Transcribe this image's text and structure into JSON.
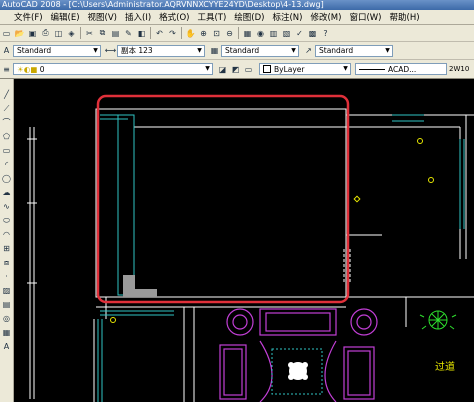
{
  "window": {
    "title": "AutoCAD 2008 - [C:\\Users\\Administrator.AQRVNNXCYYE24YD\\Desktop\\4-13.dwg]"
  },
  "menu": [
    "文件(F)",
    "编辑(E)",
    "视图(V)",
    "插入(I)",
    "格式(O)",
    "工具(T)",
    "绘图(D)",
    "标注(N)",
    "修改(M)",
    "窗口(W)",
    "帮助(H)"
  ],
  "styles": {
    "text_style": "Standard",
    "dim_style": "副本 123",
    "table_style": "Standard",
    "multileader_style": "Standard"
  },
  "layer": {
    "current": "0"
  },
  "properties": {
    "color": "ByLayer",
    "linetype": "ACAD...",
    "lineweight": "2W10"
  },
  "drawing": {
    "label": "过道"
  },
  "colors": {
    "highlight": "#e0303a",
    "walls": "#ffffff",
    "doors": "#2fc5c5",
    "furniture": "#c23fd6",
    "plants": "#2ee02e",
    "points": "#e8e800"
  }
}
